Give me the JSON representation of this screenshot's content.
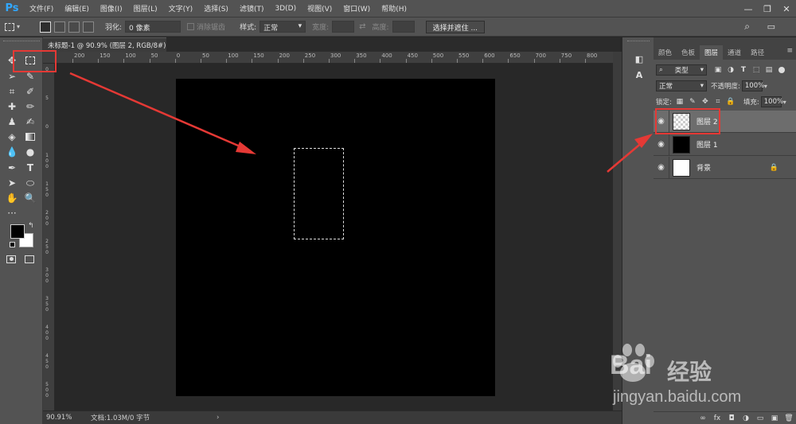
{
  "app": {
    "logo": "Ps"
  },
  "menu": [
    "文件(F)",
    "编辑(E)",
    "图像(I)",
    "图层(L)",
    "文字(Y)",
    "选择(S)",
    "滤镜(T)",
    "3D(D)",
    "视图(V)",
    "窗口(W)",
    "帮助(H)"
  ],
  "window_controls": {
    "minimize": "—",
    "restore": "❐",
    "close": "✕"
  },
  "options_bar": {
    "feather_label": "羽化:",
    "feather_value": "0 像素",
    "antialias_label": "消除锯齿",
    "style_label": "样式:",
    "style_value": "正常",
    "width_label": "宽度:",
    "height_label": "高度:",
    "select_mask_button": "选择并遮住 ...",
    "search_icon": "⌕",
    "workspace_icon": "▭"
  },
  "document": {
    "tab_title": "未标题-1 @ 90.9% (图层 2, RGB/8#) *",
    "zoom": "90.91%",
    "doc_info": "文档:1.03M/0 字节",
    "status_arrow": "›"
  },
  "ruler_top": [
    "200",
    "150",
    "100",
    "50",
    "0",
    "50",
    "100",
    "150",
    "200",
    "250",
    "300",
    "350",
    "400",
    "450",
    "500",
    "550",
    "600",
    "650",
    "700",
    "750",
    "800"
  ],
  "ruler_left": [
    "0",
    "5",
    "0",
    "1 0 0",
    "1 5 0",
    "2 0 0",
    "2 5 0",
    "3 0 0",
    "3 5 0",
    "4 0 0",
    "4 5 0",
    "5 0 0"
  ],
  "panel": {
    "tabs": [
      "颜色",
      "色板",
      "图层",
      "通道",
      "路径"
    ],
    "active_tab": "图层",
    "filter_kind": "类型",
    "blend_mode": "正常",
    "opacity_label": "不透明度:",
    "opacity_value": "100%",
    "lock_label": "锁定:",
    "fill_label": "填充:",
    "fill_value": "100%",
    "menu_icon": "≡",
    "layers": [
      {
        "name": "图层 2",
        "thumb": "checker",
        "selected": true,
        "locked": false
      },
      {
        "name": "图层 1",
        "thumb": "black",
        "selected": false,
        "locked": false
      },
      {
        "name": "背景",
        "thumb": "white",
        "selected": false,
        "locked": true
      }
    ],
    "footer_icons": [
      "∞",
      "fx",
      "◘",
      "◑",
      "▭",
      "▣",
      "🗑"
    ]
  },
  "watermark": {
    "brand": "Bai",
    "brand2": "经验",
    "url": "jingyan.baidu.com"
  },
  "colors": {
    "accent": "#31a8ff",
    "annotation": "#e53935",
    "selection_bg": "#6d6d6d"
  }
}
